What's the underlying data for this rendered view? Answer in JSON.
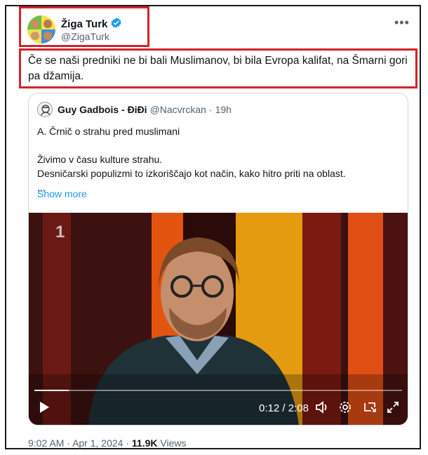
{
  "author": {
    "name": "Žiga Turk",
    "handle": "@ZigaTurk",
    "verified": true,
    "verified_color": "#1d9bf0"
  },
  "more_icon": "more-horizontal-icon",
  "tweet": {
    "text": "Če se naši predniki ne bi bali Muslimanov, bi bila Evropa kalifat, na Šmarni gori pa džamija."
  },
  "quoted": {
    "name": "Guy Gadbois - ĐiĐi",
    "handle": "@Nacvrckan",
    "separator": "·",
    "time": "19h",
    "lines": [
      "A. Črnič o strahu pred muslimani",
      "",
      "Živimo v času kulture strahu.",
      "Desničarski populizmi to izkoriščajo kot način, kako hitro priti na oblast.",
      "..."
    ],
    "show_more": "Show more",
    "video": {
      "channel_logo": "1",
      "current_time": "0:12",
      "time_separator": "/",
      "duration": "2:08",
      "progress": 0.094
    }
  },
  "meta": {
    "time": "9:02 AM",
    "separator": "·",
    "date": "Apr 1, 2024",
    "views_count": "11.9K",
    "views_label": "Views"
  },
  "colors": {
    "highlight": "#d3222a",
    "link": "#1d9bf0",
    "secondary_text": "#536471"
  }
}
